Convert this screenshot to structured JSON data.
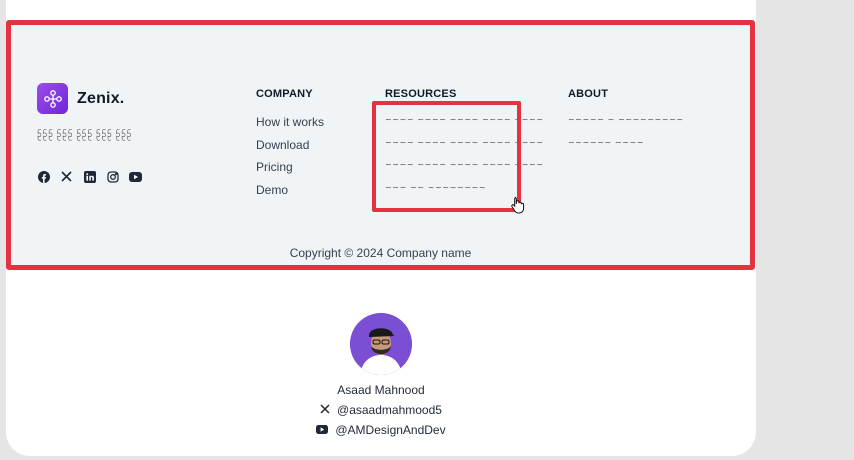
{
  "brand": {
    "name": "Zenix.",
    "tagline": "ᩐᩐᩐ ᩐᩐᩐ ᩐᩐᩐ ᩐᩐᩐ ᩐᩐᩐ"
  },
  "socials": [
    "facebook-icon",
    "x-icon",
    "linkedin-icon",
    "instagram-icon",
    "youtube-icon"
  ],
  "columns": {
    "company": {
      "heading": "COMPANY",
      "items": [
        "How it works",
        "Download",
        "Pricing",
        "Demo"
      ]
    },
    "resources": {
      "heading": "RESOURCES",
      "items": [
        "~~~~ ~~~~ ~~~~ ~~~~ ~~~~",
        "~~~~ ~~~~ ~~~~ ~~~~ ~~~~",
        "~~~~ ~~~~ ~~~~ ~~~~ ~~~~",
        "~~~ ~~ ~~~~~~~~"
      ]
    },
    "about": {
      "heading": "ABOUT",
      "items": [
        "~~~~~ ~ ~~~~~~~~~",
        "~~~~~~ ~~~~"
      ]
    }
  },
  "copyright": "Copyright © 2024 Company name",
  "author": {
    "name": "Asaad Mahnood",
    "x_handle": "@asaadmahmood5",
    "youtube_handle": "@AMDesignAndDev"
  },
  "colors": {
    "highlight": "#e63141",
    "brand": "#8b3fe6",
    "footer_bg": "#f1f4f6"
  }
}
